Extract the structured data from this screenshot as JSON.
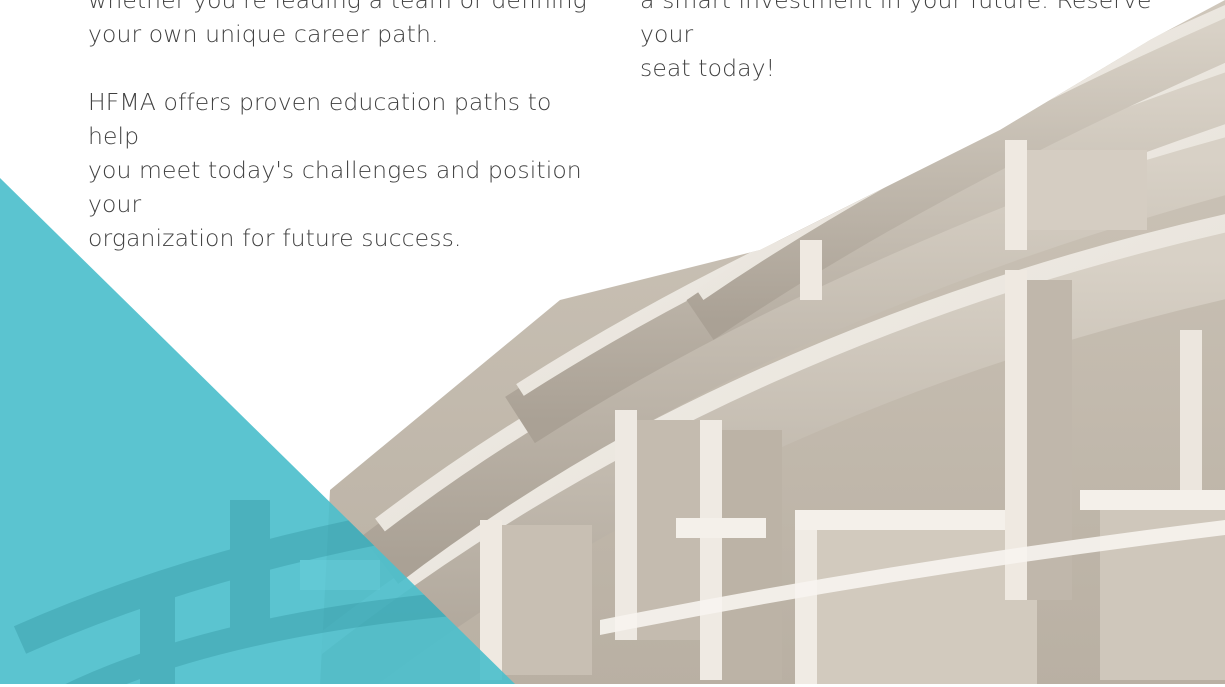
{
  "left_column": {
    "line1": "whether you're leading a team or defining",
    "line2": "your own unique career path.",
    "para2_line1": "HFMA offers proven education paths to help",
    "para2_line2": "you meet today's challenges and position your",
    "para2_line3": "organization for future success."
  },
  "right_column": {
    "line1": "a smart investment in your future. Reserve your",
    "line2": "seat today!"
  },
  "colors": {
    "accent_teal": "#4dbfcc",
    "maze_wall": "#e6e0d7",
    "maze_shadow": "#b5aca0",
    "text": "#404040"
  },
  "graphics": {
    "hero_image": "maze-illustration",
    "accent_shape": "teal-triangle"
  }
}
